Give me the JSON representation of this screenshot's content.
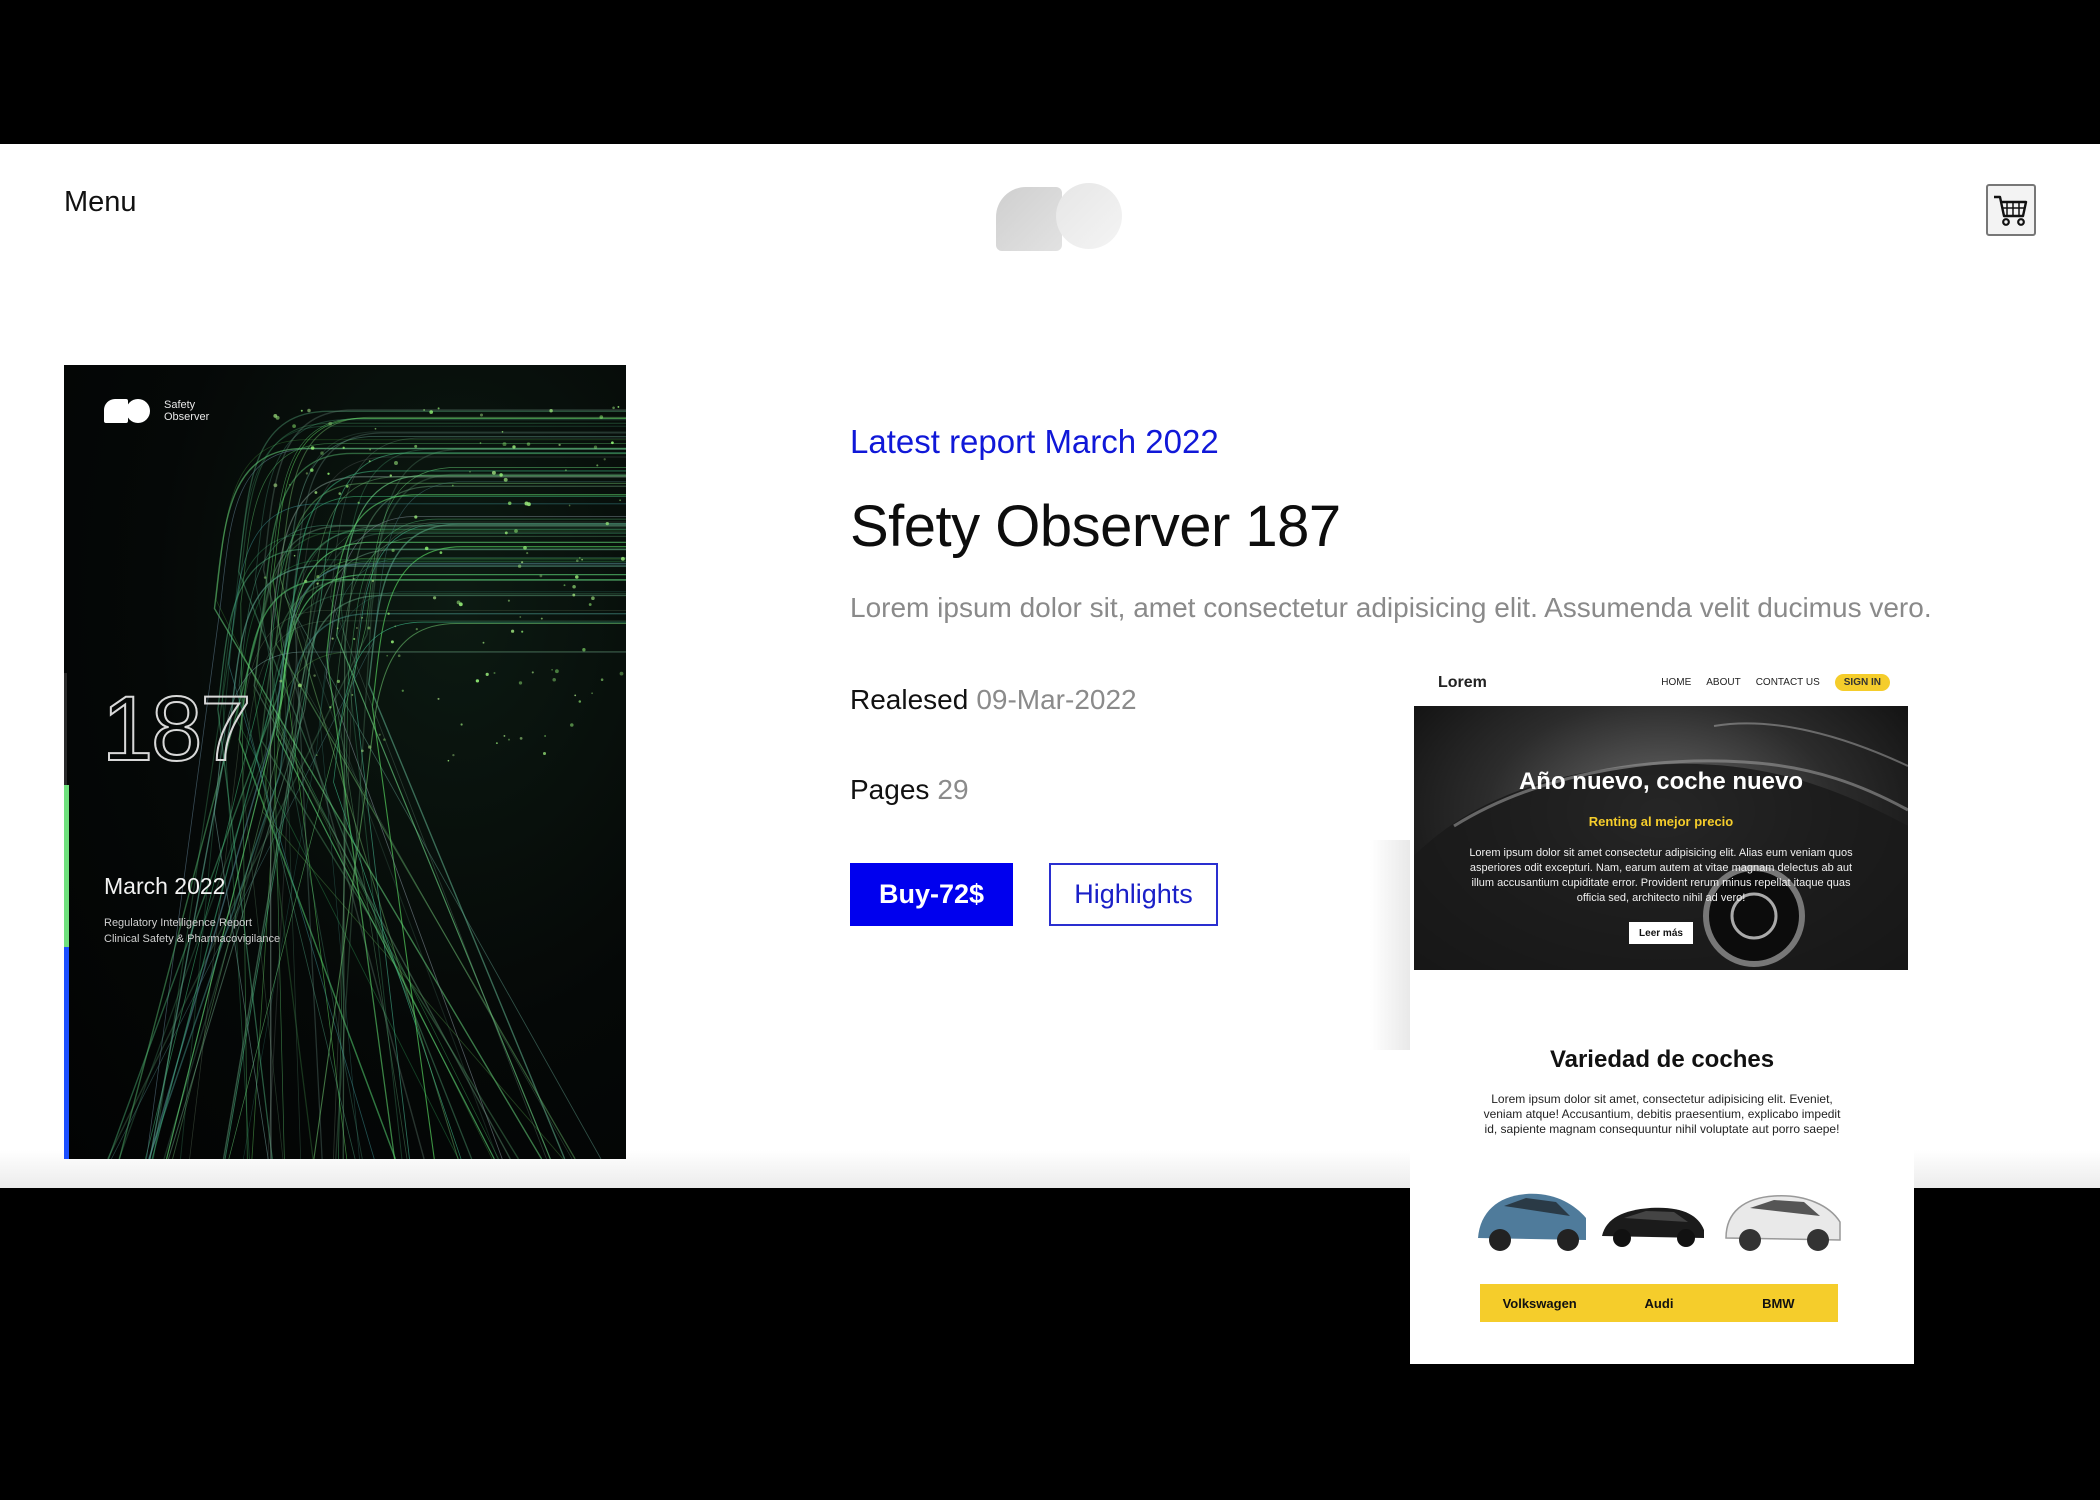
{
  "header": {
    "menu_label": "Menu",
    "logo_icon": "so-logo-icon",
    "cart_icon": "shopping-cart-icon"
  },
  "cover": {
    "brand_text": "Safety Observer",
    "issue_number": "187",
    "month": "March 2022",
    "subtitle_line1": "Regulatory Intelligence Report",
    "subtitle_line2": "Clinical Safety & Pharmacovigilance",
    "accent_green": "#6fe07d",
    "accent_blue": "#1b4fff"
  },
  "report": {
    "kicker": "Latest report March 2022",
    "title": "Sfety Observer 187",
    "description": "Lorem ipsum dolor sit, amet consectetur adipisicing elit. Assumenda velit ducimus vero.",
    "released_label": "Realesed",
    "released_value": "09-Mar-2022",
    "pages_label": "Pages",
    "pages_value": "29",
    "buy_label": "Buy-72$",
    "highlights_label": "Highlights",
    "accent_color": "#0000ee"
  },
  "mockup": {
    "brand": "Lorem",
    "nav": [
      "HOME",
      "ABOUT",
      "CONTACT US"
    ],
    "signin": "SIGN IN",
    "hero_title": "Año nuevo, coche nuevo",
    "hero_sub": "Renting al mejor precio",
    "hero_text": "Lorem ipsum dolor sit amet consectetur adipisicing elit. Alias eum veniam quos asperiores odit excepturi. Nam, earum autem at vitae magnam delectus ab aut illum accusantium cupiditate error. Provident rerum minus repellat itaque quas officia sed, architecto nihil ad vero!",
    "hero_button": "Leer más",
    "section_title": "Variedad de coches",
    "section_text": "Lorem ipsum dolor sit amet, consectetur adipisicing elit. Eveniet, veniam atque! Accusantium, debitis praesentium, explicabo impedit id, sapiente magnam consequuntur nihil voluptate aut porro saepe!",
    "brands": [
      "Volkswagen",
      "Audi",
      "BMW"
    ],
    "accent_yellow": "#f5cd2b"
  }
}
